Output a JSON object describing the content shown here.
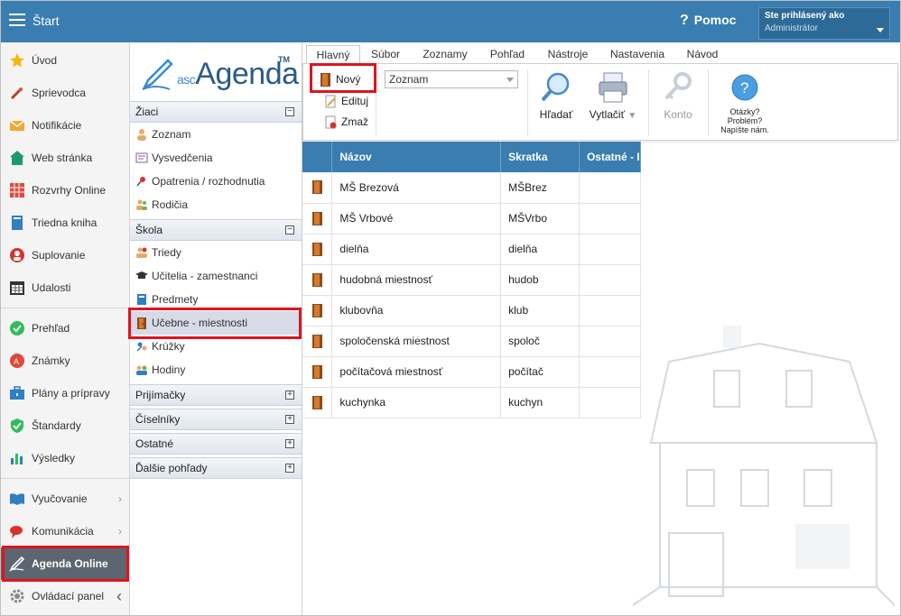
{
  "header": {
    "title": "Štart",
    "help_label": "Pomoc",
    "user_line1": "Ste prihlásený ako",
    "user_line2": "Administrátor"
  },
  "leftnav": {
    "items": [
      {
        "label": "Úvod",
        "icon": "star-icon"
      },
      {
        "label": "Sprievodca",
        "icon": "wand-icon"
      },
      {
        "label": "Notifikácie",
        "icon": "envelope-icon"
      },
      {
        "label": "Web stránka",
        "icon": "house-icon"
      },
      {
        "label": "Rozvrhy Online",
        "icon": "timetable-icon"
      },
      {
        "label": "Triedna kniha",
        "icon": "book-icon"
      },
      {
        "label": "Suplovanie",
        "icon": "substitution-icon"
      },
      {
        "label": "Udalosti",
        "icon": "calendar-icon"
      },
      {
        "label": "Prehľad",
        "icon": "check-icon"
      },
      {
        "label": "Známky",
        "icon": "grades-icon"
      },
      {
        "label": "Plány a prípravy",
        "icon": "briefcase-icon"
      },
      {
        "label": "Štandardy",
        "icon": "shield-icon"
      },
      {
        "label": "Výsledky",
        "icon": "chart-icon"
      },
      {
        "label": "Vyučovanie",
        "icon": "open-book-icon"
      },
      {
        "label": "Komunikácia",
        "icon": "chat-icon"
      },
      {
        "label": "Agenda Online",
        "icon": "agenda-icon"
      },
      {
        "label": "Ovládací panel",
        "icon": "gear-icon"
      }
    ]
  },
  "midpanel": {
    "logo_prefix": "asc",
    "logo_main": "Agenda",
    "logo_tm": "TM",
    "sections": {
      "ziaci": "Žiaci",
      "skola": "Škola",
      "prijimacky": "Prijímačky",
      "ciselniky": "Číselníky",
      "ostatne": "Ostatné",
      "dalsie": "Ďalšie pohľady"
    },
    "ziaci_items": [
      "Zoznam",
      "Vysvedčenia",
      "Opatrenia / rozhodnutia",
      "Rodičia"
    ],
    "skola_items": [
      "Triedy",
      "Učitelia - zamestnanci",
      "Predmety",
      "Učebne - miestnosti",
      "Krúžky",
      "Hodiny"
    ]
  },
  "ribbon": {
    "tabs": [
      "Hlavný",
      "Súbor",
      "Zoznamy",
      "Pohľad",
      "Nástroje",
      "Nastavenia",
      "Návod"
    ],
    "new_label": "Nový",
    "edit_label": "Edituj",
    "delete_label": "Zmaž",
    "view_select": "Zoznam",
    "search_label": "Hľadať",
    "print_label": "Vytlačiť",
    "account_label": "Konto",
    "help_line1": "Otázky?",
    "help_line2": "Problém?",
    "help_line3": "Napíšte nám."
  },
  "table": {
    "columns": [
      "Názov",
      "Skratka",
      "Ostatné - I"
    ],
    "rows": [
      {
        "name": "MŠ Brezová",
        "short": "MŠBrez"
      },
      {
        "name": "MŠ Vrbové",
        "short": "MŠVrbo"
      },
      {
        "name": "dielňa",
        "short": "dielňa"
      },
      {
        "name": "hudobná miestnosť",
        "short": "hudob"
      },
      {
        "name": "klubovňa",
        "short": "klub"
      },
      {
        "name": "spoločenská miestnost",
        "short": "spoloč"
      },
      {
        "name": "počítačová miestnosť",
        "short": "počítač"
      },
      {
        "name": "kuchynka",
        "short": "kuchyn"
      }
    ]
  },
  "colors": {
    "header_blue": "#3a7db0",
    "highlight_red": "#e0141e",
    "nav_active": "#5b6670"
  }
}
